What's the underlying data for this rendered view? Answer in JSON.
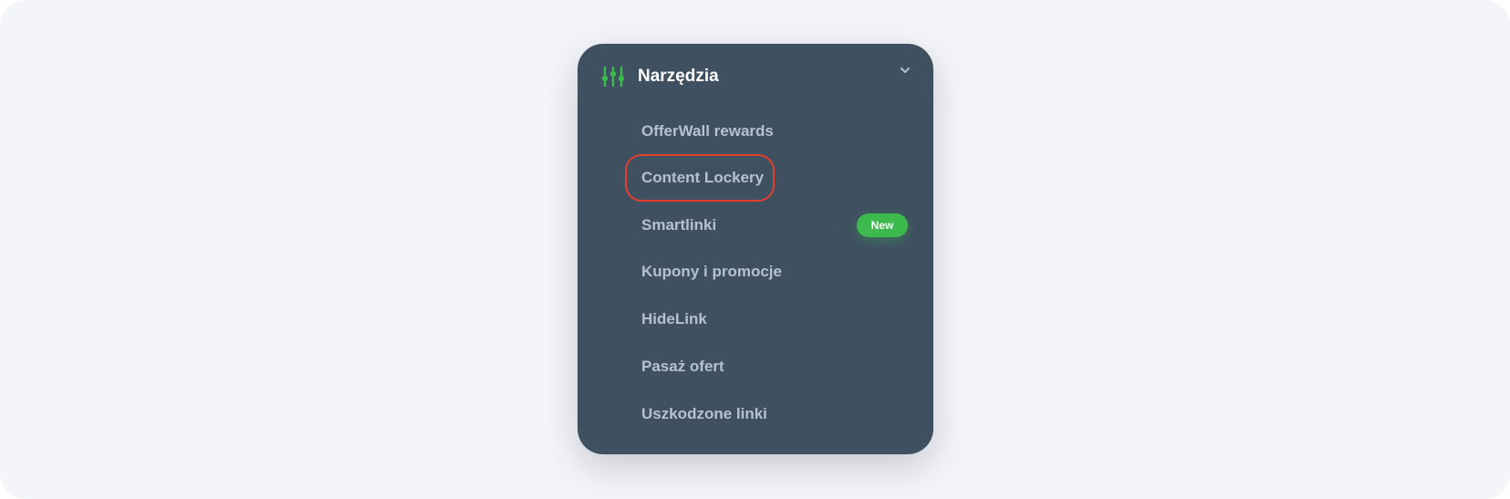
{
  "menu": {
    "title": "Narzędzia",
    "header_icon": "sliders-icon",
    "toggle_icon": "chevron-down-icon",
    "items": [
      {
        "label": "OfferWall rewards"
      },
      {
        "label": "Content Lockery",
        "highlighted": true
      },
      {
        "label": "Smartlinki",
        "badge": "New"
      },
      {
        "label": "Kupony i promocje"
      },
      {
        "label": "HideLink"
      },
      {
        "label": "Pasaż ofert"
      },
      {
        "label": "Uszkodzone linki"
      }
    ]
  },
  "colors": {
    "panel_bg": "#3f5061",
    "accent_green": "#3dba4e",
    "highlight_red": "#e53d2f",
    "item_text": "#b6c1cd",
    "title_text": "#ffffff"
  }
}
